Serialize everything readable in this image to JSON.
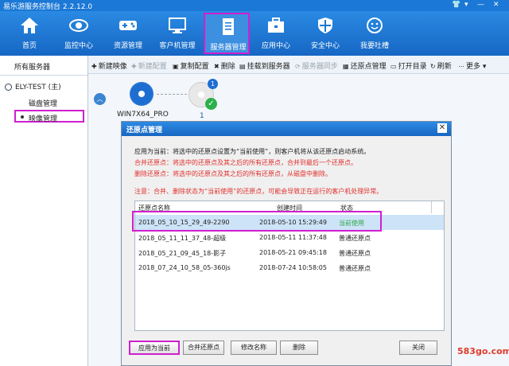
{
  "window": {
    "title": "易乐游服务控制台 2.2.12.0"
  },
  "nav": {
    "items": [
      {
        "label": "首页"
      },
      {
        "label": "监控中心"
      },
      {
        "label": "资源管理"
      },
      {
        "label": "客户机管理"
      },
      {
        "label": "服务器管理"
      },
      {
        "label": "应用中心"
      },
      {
        "label": "安全中心"
      },
      {
        "label": "我要吐槽"
      }
    ],
    "active": "服务器管理"
  },
  "sidebar": {
    "header": "所有服务器",
    "server": "ELY-TEST (主)",
    "items": [
      {
        "label": "磁盘管理"
      },
      {
        "label": "映像管理"
      }
    ]
  },
  "toolbar": {
    "items": [
      {
        "label": "新建映像",
        "enabled": true
      },
      {
        "label": "新建配置",
        "enabled": false
      },
      {
        "label": "复制配置",
        "enabled": true
      },
      {
        "label": "删除",
        "enabled": true
      },
      {
        "label": "挂载到服务器",
        "enabled": true
      },
      {
        "label": "服务器同步",
        "enabled": false
      },
      {
        "label": "还原点管理",
        "enabled": true
      },
      {
        "label": "打开目录",
        "enabled": true
      },
      {
        "label": "刷新",
        "enabled": true
      },
      {
        "label": "更多",
        "enabled": true
      }
    ]
  },
  "images": {
    "main": "WIN7X64_PRO",
    "point_label": "1",
    "badge": "1"
  },
  "dialog": {
    "title": "还原点管理",
    "desc": [
      "应用为当前：将选中的还原点设置为“当前使用”，则客户机将从该还原点启动系统。",
      "合并还原点：将选中的还原点及其之后的所有还原点，合并到最后一个还原点。",
      "删除还原点：将选中的还原点及其之后的所有还原点，从磁盘中删除。",
      "注意：合并、删除状态为“当前使用”的还原点，可能会导致正在运行的客户机处理异常。"
    ],
    "columns": [
      "还原点名称",
      "创建时间",
      "状态"
    ],
    "rows": [
      {
        "name": "2018_05_10_15_29_49-2290",
        "time": "2018-05-10 15:29:49",
        "status": "当前使用"
      },
      {
        "name": "2018_05_11_11_37_48-超级",
        "time": "2018-05-11 11:37:48",
        "status": "普通还原点"
      },
      {
        "name": "2018_05_21_09_45_18-影子",
        "time": "2018-05-21 09:45:18",
        "status": "普通还原点"
      },
      {
        "name": "2018_07_24_10_58_05-360js",
        "time": "2018-07-24 10:58:05",
        "status": "普通还原点"
      }
    ],
    "buttons": {
      "apply": "应用为当前",
      "merge": "合并还原点",
      "rename": "修改名称",
      "delete": "删除",
      "close": "关闭"
    }
  },
  "watermark": "583go.com",
  "colors": {
    "accent": "#1b78d6",
    "highlight": "#d01fd0",
    "selected_row": "#cde3f7",
    "status_current": "#2aa84a",
    "warning": "#e0302c"
  }
}
